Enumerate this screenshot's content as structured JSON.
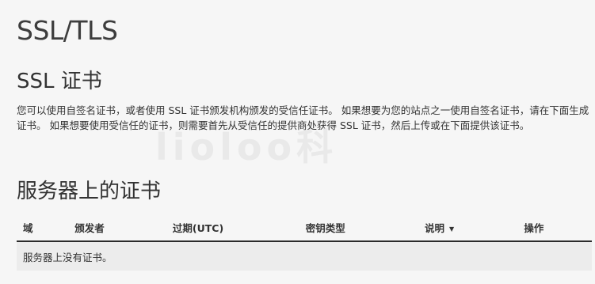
{
  "page": {
    "title": "SSL/TLS"
  },
  "ssl_section": {
    "title": "SSL 证书",
    "description": "您可以使用自签名证书，或者使用 SSL 证书颁发机构颁发的受信任证书。 如果想要为您的站点之一使用自签名证书，请在下面生成证书。 如果想要使用受信任的证书，则需要首先从受信任的提供商处获得 SSL 证书，然后上传或在下面提供该证书。"
  },
  "server_certs": {
    "title": "服务器上的证书",
    "columns": {
      "domain": "域",
      "issuer": "颁发者",
      "expires": "过期(UTC)",
      "key_type": "密钥类型",
      "description": "说明",
      "actions": "操作"
    },
    "sort_icon": "caret-down-icon",
    "empty_message": "服务器上没有证书。"
  },
  "watermark": {
    "text": "lioloo科"
  }
}
